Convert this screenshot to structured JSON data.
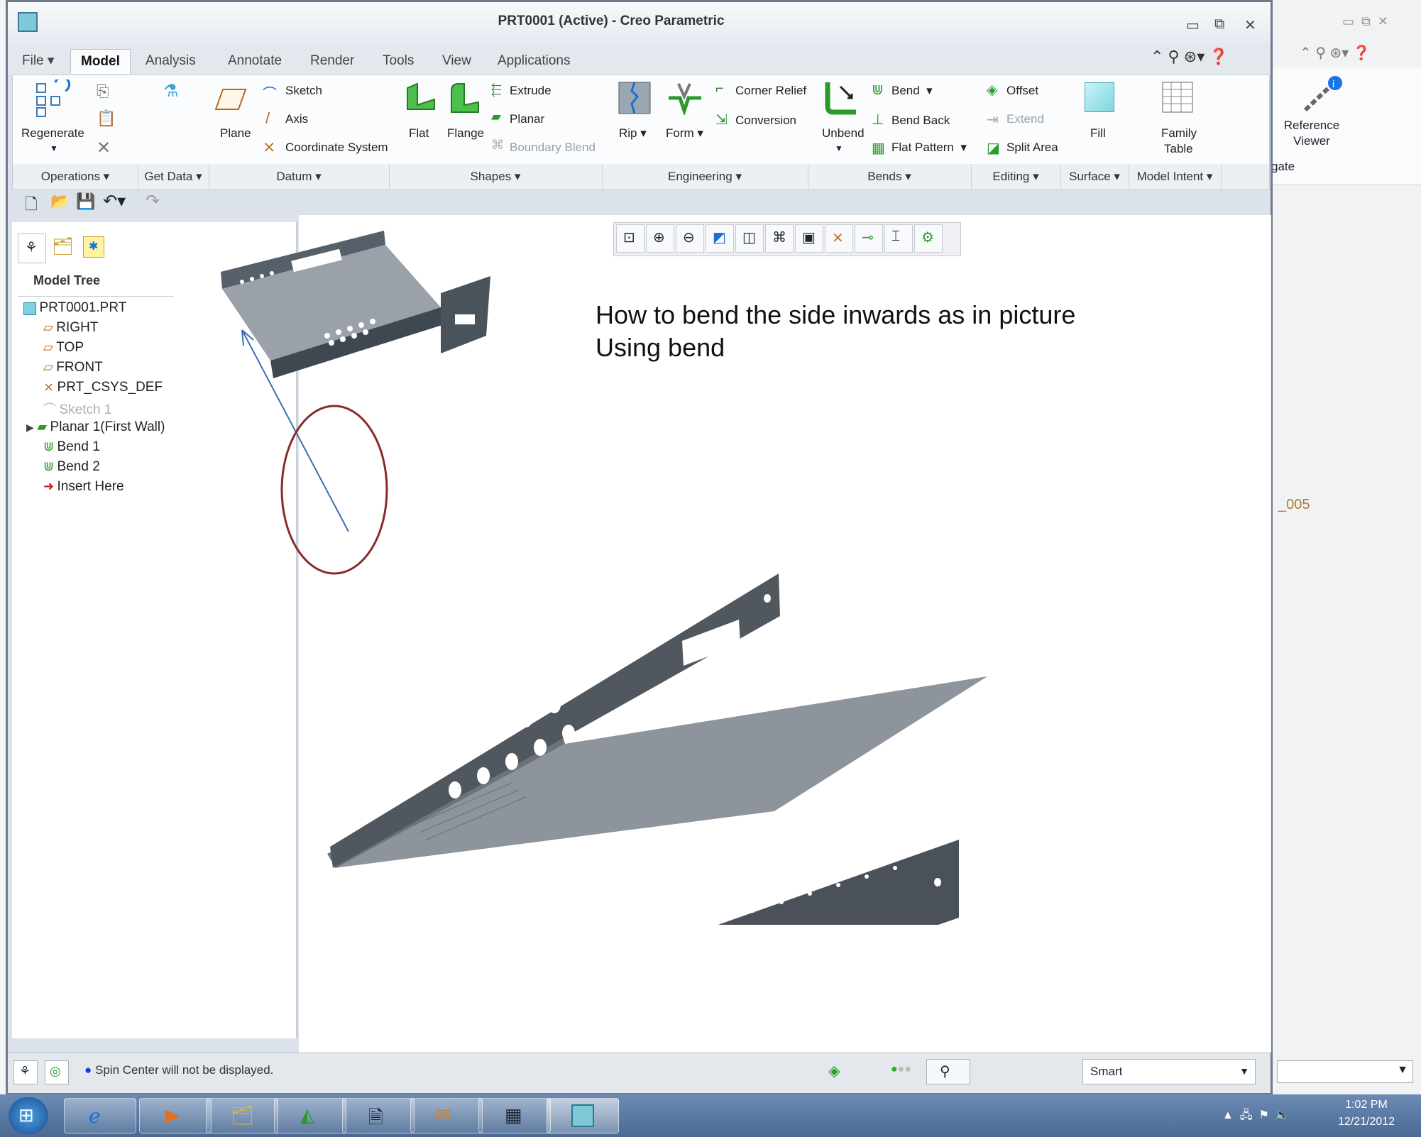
{
  "window": {
    "title": "PRT0001 (Active) - Creo Parametric"
  },
  "tabs": [
    "File",
    "Model",
    "Analysis",
    "Annotate",
    "Render",
    "Tools",
    "View",
    "Applications"
  ],
  "ribbon": {
    "regenerate": "Regenerate",
    "plane": "Plane",
    "sketch": "Sketch",
    "axis": "Axis",
    "coordinate_system": "Coordinate System",
    "flat": "Flat",
    "flange": "Flange",
    "extrude": "Extrude",
    "planar": "Planar",
    "boundary_blend": "Boundary Blend",
    "rip": "Rip",
    "form": "Form",
    "corner_relief": "Corner Relief",
    "conversion": "Conversion",
    "unbend": "Unbend",
    "bend": "Bend",
    "bend_back": "Bend Back",
    "flat_pattern": "Flat Pattern",
    "offset": "Offset",
    "extend": "Extend",
    "split_area": "Split Area",
    "fill": "Fill",
    "family_table_1": "Family",
    "family_table_2": "Table"
  },
  "groups": [
    "Operations",
    "Get Data",
    "Datum",
    "Shapes",
    "Engineering",
    "Bends",
    "Editing",
    "Surface",
    "Model Intent"
  ],
  "model_tree": {
    "header": "Model Tree",
    "items": [
      "PRT0001.PRT",
      "RIGHT",
      "TOP",
      "FRONT",
      "PRT_CSYS_DEF",
      "Sketch 1",
      "Planar 1(First Wall)",
      "Bend 1",
      "Bend 2",
      "Insert Here"
    ]
  },
  "annotation": {
    "line1": "How to bend the side inwards as in picture",
    "line2": "Using bend"
  },
  "status": {
    "message": "Spin Center will not be displayed.",
    "filter": "Smart"
  },
  "background_window": {
    "reference_1": "Reference",
    "reference_2": "Viewer",
    "partial_label": "gate",
    "side_text": "_005"
  },
  "taskbar": {
    "time": "1:02 PM",
    "date": "12/21/2012"
  },
  "colors": {
    "sheet_metal": "#7b8088",
    "annotation_ellipse": "#8a2a2a",
    "arrow": "#3b6fb0",
    "datum_orange": "#c07a2a",
    "accent_green": "#3aa53a"
  }
}
